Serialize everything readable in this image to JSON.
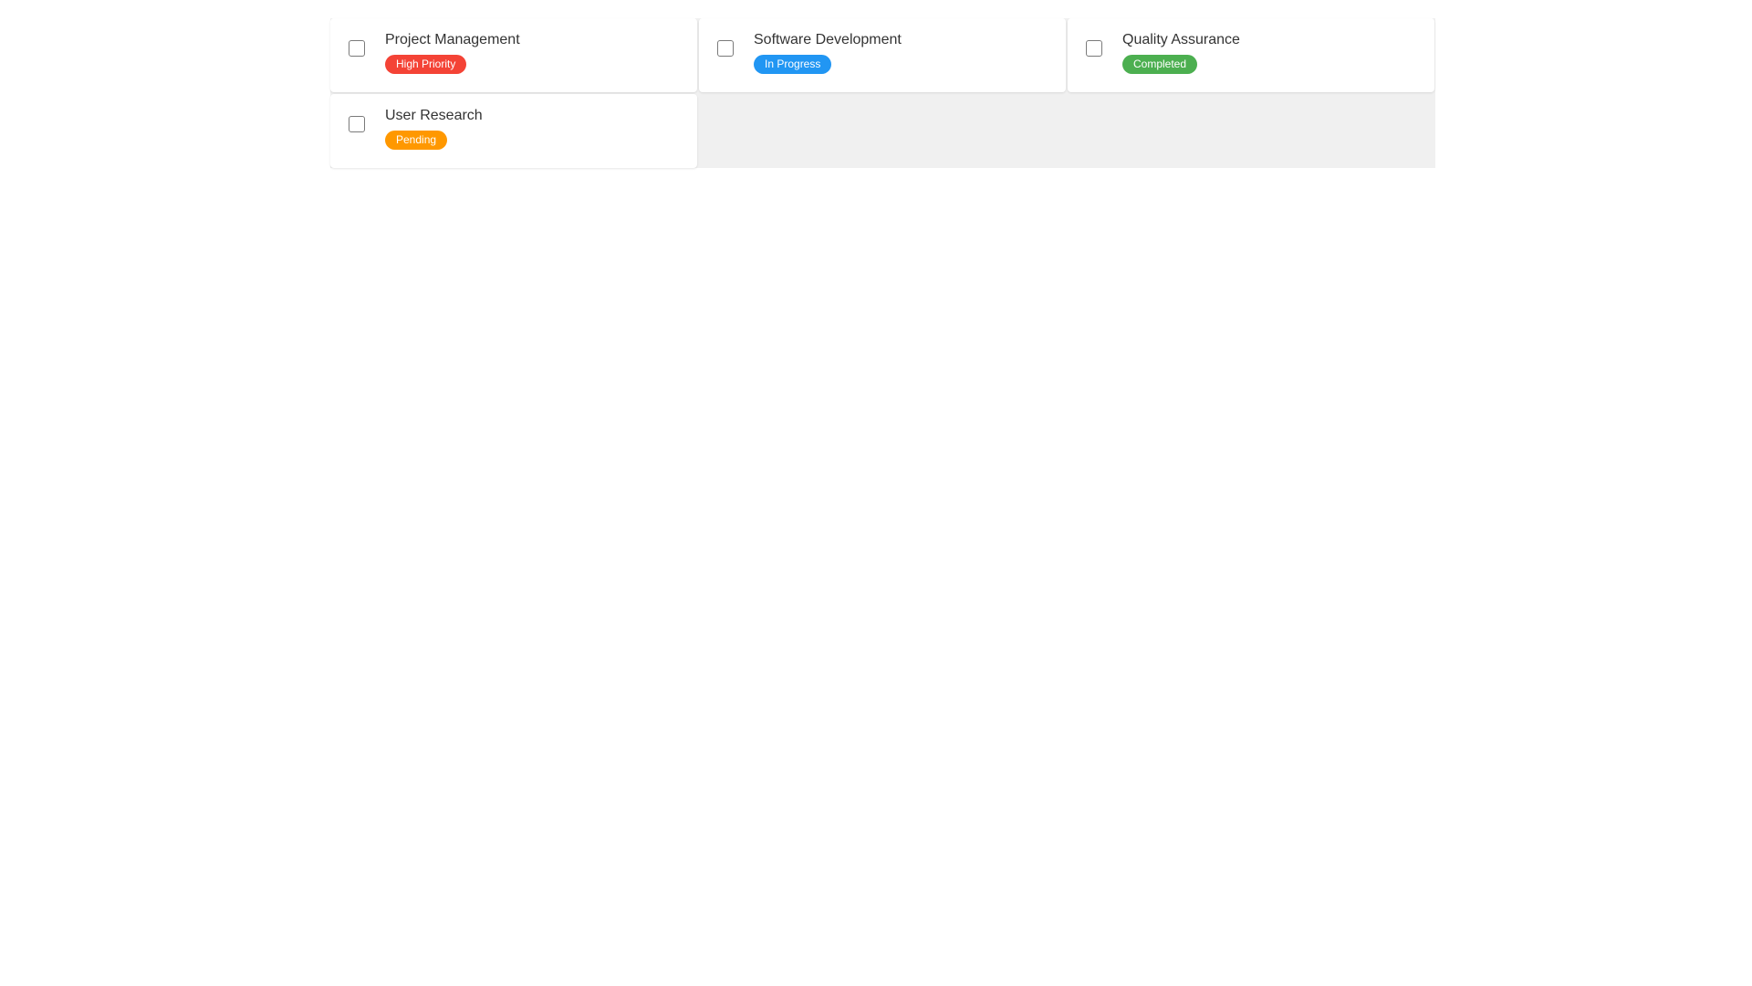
{
  "tasks": [
    {
      "title": "Project Management",
      "status": "High Priority",
      "status_color": "#f44336",
      "checked": false
    },
    {
      "title": "Software Development",
      "status": "In Progress",
      "status_color": "#2196f3",
      "checked": false
    },
    {
      "title": "Quality Assurance",
      "status": "Completed",
      "status_color": "#4caf50",
      "checked": false
    },
    {
      "title": "User Research",
      "status": "Pending",
      "status_color": "#ff9800",
      "checked": false
    }
  ],
  "colors": {
    "grid_background": "#f0f0f0",
    "card_background": "#ffffff",
    "title_text": "#333333",
    "checkbox_border": "#7a7a7a"
  }
}
